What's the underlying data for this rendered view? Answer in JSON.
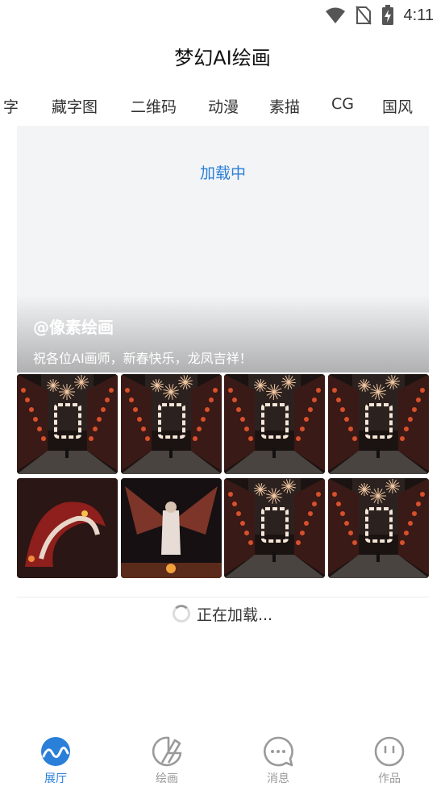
{
  "status_bar": {
    "time": "4:11",
    "icons": [
      "wifi-icon",
      "no-sim-icon",
      "battery-charging-icon"
    ]
  },
  "app": {
    "title": "梦幻AI绘画"
  },
  "categories": [
    {
      "label": "字"
    },
    {
      "label": "藏字图"
    },
    {
      "label": "二维码"
    },
    {
      "label": "动漫"
    },
    {
      "label": "素描"
    },
    {
      "label": "CG"
    },
    {
      "label": "国风"
    }
  ],
  "banner": {
    "loading_text": "加载中",
    "author": "@像素绘画",
    "caption": "祝各位AI画师，新春快乐，龙凤吉祥！"
  },
  "gallery": {
    "images": [
      {
        "subject": "street-fireworks-glyph-新"
      },
      {
        "subject": "street-fireworks-glyph-年"
      },
      {
        "subject": "street-fireworks-glyph-快"
      },
      {
        "subject": "street-fireworks-glyph-乐"
      },
      {
        "subject": "red-dragon"
      },
      {
        "subject": "phoenix"
      },
      {
        "subject": "street-fireworks-glyph-吉"
      },
      {
        "subject": "street-fireworks-glyph-祥"
      }
    ]
  },
  "load_more": {
    "text": "正在加载..."
  },
  "bottom_nav": {
    "items": [
      {
        "label": "展厅",
        "icon": "wave-circle-icon",
        "active": true
      },
      {
        "label": "绘画",
        "icon": "palette-icon",
        "active": false
      },
      {
        "label": "消息",
        "icon": "chat-bubble-icon",
        "active": false
      },
      {
        "label": "作品",
        "icon": "smiley-face-icon",
        "active": false
      }
    ]
  },
  "colors": {
    "accent": "#2a7fd8",
    "inactive": "#9a9a9a",
    "banner_bg": "#f3f4f6"
  }
}
